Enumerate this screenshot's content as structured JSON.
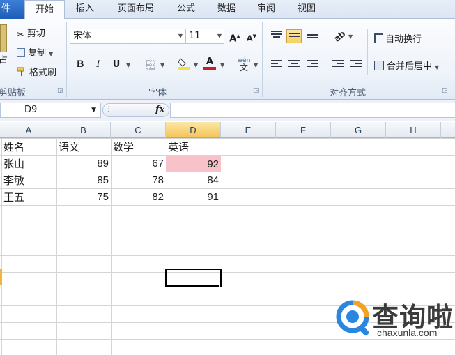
{
  "tabs": [
    {
      "label": "件",
      "active": false
    },
    {
      "label": "开始",
      "active": true
    },
    {
      "label": "插入",
      "active": false
    },
    {
      "label": "页面布局",
      "active": false
    },
    {
      "label": "公式",
      "active": false
    },
    {
      "label": "数据",
      "active": false
    },
    {
      "label": "审阅",
      "active": false
    },
    {
      "label": "视图",
      "active": false
    }
  ],
  "clipboard": {
    "paste_label": "占",
    "cut_label": "剪切",
    "copy_label": "复制",
    "format_painter_label": "格式刷",
    "group_label": "剪贴板"
  },
  "font": {
    "name": "宋体",
    "size": "11",
    "bold": "B",
    "italic": "I",
    "underline": "U",
    "font_color_letter": "A",
    "font_color": "#c0202a",
    "fill_color": "#f4e04a",
    "phonetic_label": "wén",
    "group_label": "字体"
  },
  "alignment": {
    "wrap_label": "自动换行",
    "merge_label": "合并后居中",
    "group_label": "对齐方式"
  },
  "formula_bar": {
    "name_box": "D9",
    "fx_label": "fx",
    "value": ""
  },
  "sheet": {
    "columns": [
      "A",
      "B",
      "C",
      "D",
      "E",
      "F",
      "G",
      "H"
    ],
    "active_column": "D",
    "rows": [
      [
        "姓名",
        "语文",
        "数学",
        "英语"
      ],
      [
        "张山",
        "89",
        "67",
        "92"
      ],
      [
        "李敏",
        "85",
        "78",
        "84"
      ],
      [
        "王五",
        "75",
        "82",
        "91"
      ]
    ],
    "highlight_cell": "D2",
    "highlight_color": "#f7c2c9",
    "selected_cell": "D9",
    "accent_color": "#e2a32a"
  },
  "watermark": {
    "title": "查询啦",
    "url": "chaxunla.com"
  }
}
